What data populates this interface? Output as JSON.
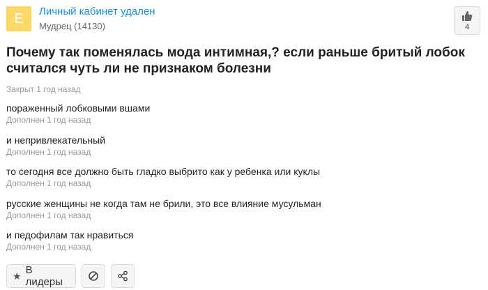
{
  "author": {
    "avatar_letter": "Е",
    "name": "Личный кабинет удален",
    "rank": "Мудрец (14130)"
  },
  "like": {
    "count": "4"
  },
  "question": {
    "title": "Почему так поменялась мода интимная,? если раньше бритый лобок считался чуть ли не признаком болезни",
    "closed": "Закрыт 1 год назад"
  },
  "additions": [
    {
      "text": "пораженный лобковыми вшами",
      "meta": "Дополнен 1 год назад"
    },
    {
      "text": "и непривлекательный",
      "meta": "Дополнен 1 год назад"
    },
    {
      "text": "то сегодня все должно быть гладко выбрито как у ребенка или куклы",
      "meta": "Дополнен 1 год назад"
    },
    {
      "text": "русские женщины не когда там не брили, это все влияние мусульман",
      "meta": "Дополнен 1 год назад"
    },
    {
      "text": "и педофилам так нравиться",
      "meta": "Дополнен 1 год назад"
    }
  ],
  "actions": {
    "leaders_label": "В лидеры"
  },
  "colors": {
    "link": "#168de2",
    "avatar": "#fcd866",
    "muted": "#999999"
  }
}
